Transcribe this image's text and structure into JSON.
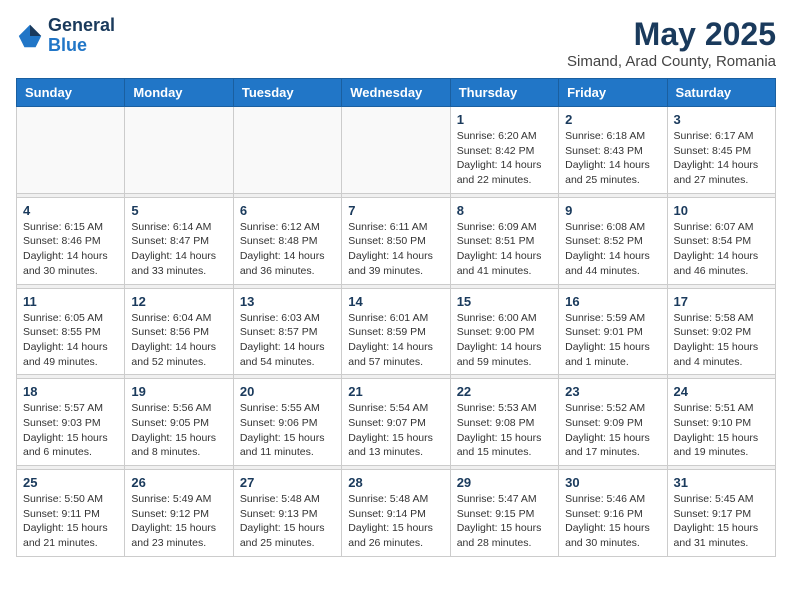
{
  "logo": {
    "line1": "General",
    "line2": "Blue"
  },
  "title": "May 2025",
  "subtitle": "Simand, Arad County, Romania",
  "weekdays": [
    "Sunday",
    "Monday",
    "Tuesday",
    "Wednesday",
    "Thursday",
    "Friday",
    "Saturday"
  ],
  "weeks": [
    [
      {
        "day": "",
        "info": ""
      },
      {
        "day": "",
        "info": ""
      },
      {
        "day": "",
        "info": ""
      },
      {
        "day": "",
        "info": ""
      },
      {
        "day": "1",
        "info": "Sunrise: 6:20 AM\nSunset: 8:42 PM\nDaylight: 14 hours\nand 22 minutes."
      },
      {
        "day": "2",
        "info": "Sunrise: 6:18 AM\nSunset: 8:43 PM\nDaylight: 14 hours\nand 25 minutes."
      },
      {
        "day": "3",
        "info": "Sunrise: 6:17 AM\nSunset: 8:45 PM\nDaylight: 14 hours\nand 27 minutes."
      }
    ],
    [
      {
        "day": "4",
        "info": "Sunrise: 6:15 AM\nSunset: 8:46 PM\nDaylight: 14 hours\nand 30 minutes."
      },
      {
        "day": "5",
        "info": "Sunrise: 6:14 AM\nSunset: 8:47 PM\nDaylight: 14 hours\nand 33 minutes."
      },
      {
        "day": "6",
        "info": "Sunrise: 6:12 AM\nSunset: 8:48 PM\nDaylight: 14 hours\nand 36 minutes."
      },
      {
        "day": "7",
        "info": "Sunrise: 6:11 AM\nSunset: 8:50 PM\nDaylight: 14 hours\nand 39 minutes."
      },
      {
        "day": "8",
        "info": "Sunrise: 6:09 AM\nSunset: 8:51 PM\nDaylight: 14 hours\nand 41 minutes."
      },
      {
        "day": "9",
        "info": "Sunrise: 6:08 AM\nSunset: 8:52 PM\nDaylight: 14 hours\nand 44 minutes."
      },
      {
        "day": "10",
        "info": "Sunrise: 6:07 AM\nSunset: 8:54 PM\nDaylight: 14 hours\nand 46 minutes."
      }
    ],
    [
      {
        "day": "11",
        "info": "Sunrise: 6:05 AM\nSunset: 8:55 PM\nDaylight: 14 hours\nand 49 minutes."
      },
      {
        "day": "12",
        "info": "Sunrise: 6:04 AM\nSunset: 8:56 PM\nDaylight: 14 hours\nand 52 minutes."
      },
      {
        "day": "13",
        "info": "Sunrise: 6:03 AM\nSunset: 8:57 PM\nDaylight: 14 hours\nand 54 minutes."
      },
      {
        "day": "14",
        "info": "Sunrise: 6:01 AM\nSunset: 8:59 PM\nDaylight: 14 hours\nand 57 minutes."
      },
      {
        "day": "15",
        "info": "Sunrise: 6:00 AM\nSunset: 9:00 PM\nDaylight: 14 hours\nand 59 minutes."
      },
      {
        "day": "16",
        "info": "Sunrise: 5:59 AM\nSunset: 9:01 PM\nDaylight: 15 hours\nand 1 minute."
      },
      {
        "day": "17",
        "info": "Sunrise: 5:58 AM\nSunset: 9:02 PM\nDaylight: 15 hours\nand 4 minutes."
      }
    ],
    [
      {
        "day": "18",
        "info": "Sunrise: 5:57 AM\nSunset: 9:03 PM\nDaylight: 15 hours\nand 6 minutes."
      },
      {
        "day": "19",
        "info": "Sunrise: 5:56 AM\nSunset: 9:05 PM\nDaylight: 15 hours\nand 8 minutes."
      },
      {
        "day": "20",
        "info": "Sunrise: 5:55 AM\nSunset: 9:06 PM\nDaylight: 15 hours\nand 11 minutes."
      },
      {
        "day": "21",
        "info": "Sunrise: 5:54 AM\nSunset: 9:07 PM\nDaylight: 15 hours\nand 13 minutes."
      },
      {
        "day": "22",
        "info": "Sunrise: 5:53 AM\nSunset: 9:08 PM\nDaylight: 15 hours\nand 15 minutes."
      },
      {
        "day": "23",
        "info": "Sunrise: 5:52 AM\nSunset: 9:09 PM\nDaylight: 15 hours\nand 17 minutes."
      },
      {
        "day": "24",
        "info": "Sunrise: 5:51 AM\nSunset: 9:10 PM\nDaylight: 15 hours\nand 19 minutes."
      }
    ],
    [
      {
        "day": "25",
        "info": "Sunrise: 5:50 AM\nSunset: 9:11 PM\nDaylight: 15 hours\nand 21 minutes."
      },
      {
        "day": "26",
        "info": "Sunrise: 5:49 AM\nSunset: 9:12 PM\nDaylight: 15 hours\nand 23 minutes."
      },
      {
        "day": "27",
        "info": "Sunrise: 5:48 AM\nSunset: 9:13 PM\nDaylight: 15 hours\nand 25 minutes."
      },
      {
        "day": "28",
        "info": "Sunrise: 5:48 AM\nSunset: 9:14 PM\nDaylight: 15 hours\nand 26 minutes."
      },
      {
        "day": "29",
        "info": "Sunrise: 5:47 AM\nSunset: 9:15 PM\nDaylight: 15 hours\nand 28 minutes."
      },
      {
        "day": "30",
        "info": "Sunrise: 5:46 AM\nSunset: 9:16 PM\nDaylight: 15 hours\nand 30 minutes."
      },
      {
        "day": "31",
        "info": "Sunrise: 5:45 AM\nSunset: 9:17 PM\nDaylight: 15 hours\nand 31 minutes."
      }
    ]
  ]
}
